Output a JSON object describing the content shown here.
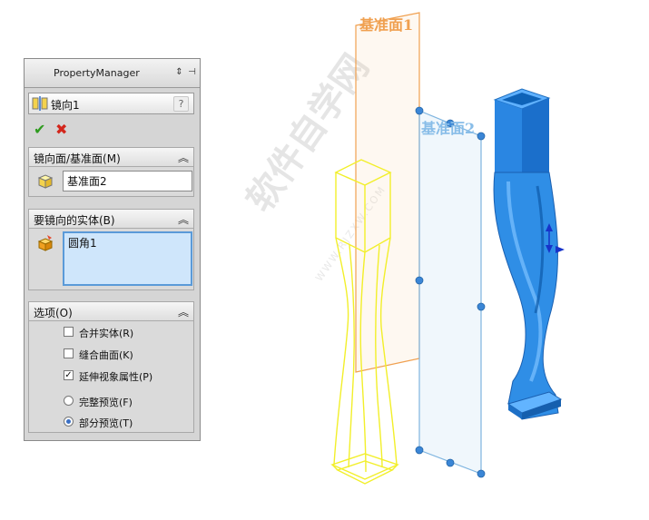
{
  "property_manager": {
    "title": "PropertyManager",
    "header_icons": [
      "expand-collapse-icon",
      "pin-icon"
    ],
    "feature": {
      "icon": "mirror-feature-icon",
      "name": "镜向1",
      "help": "?"
    },
    "ok_icon": "✔",
    "cancel_icon": "✖",
    "groups": {
      "mirror_plane": {
        "title": "镜向面/基准面(M)",
        "value": "基准面2",
        "icon": "plane-icon"
      },
      "bodies": {
        "title": "要镜向的实体(B)",
        "items": [
          "圆角1"
        ],
        "icon": "solid-body-icon"
      },
      "options": {
        "title": "选项(O)",
        "checkboxes": [
          {
            "label": "合并实体(R)",
            "checked": false
          },
          {
            "label": "缝合曲面(K)",
            "checked": false
          },
          {
            "label": "延伸视象属性(P)",
            "checked": true
          }
        ],
        "radios": [
          {
            "label": "完整预览(F)",
            "selected": false
          },
          {
            "label": "部分预览(T)",
            "selected": true
          }
        ]
      }
    },
    "collapse_glyph": "︽"
  },
  "viewport": {
    "plane1_label": "基准面1",
    "plane2_label": "基准面2",
    "watermark": "软件自学网",
    "watermark_sub": "WWW.RJZXW.COM",
    "colors": {
      "plane1": "#f0a050",
      "plane2": "#88bde8",
      "preview": "#f2ef2a",
      "solid": "#2f8ee6",
      "handle": "#3b86d6"
    }
  }
}
